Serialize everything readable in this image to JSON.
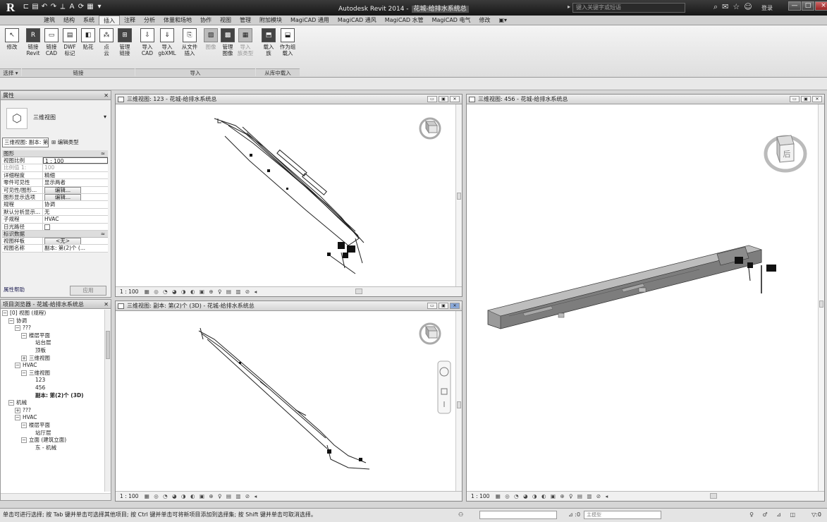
{
  "app": {
    "title": "Autodesk Revit 2014 -",
    "document": "花城-给排水系统总",
    "logo": "R",
    "qat_icons": [
      "open-icon",
      "save-icon",
      "undo-icon",
      "redo-icon",
      "measure-icon",
      "text-icon",
      "sync-icon",
      "switch-windows-icon",
      "dropdown-icon"
    ],
    "search_placeholder": "键入关键字或短语",
    "login": "登录",
    "win_minimize": "—",
    "win_restore": "□",
    "win_close": "×"
  },
  "ribbon": {
    "tabs": [
      {
        "label": "建筑"
      },
      {
        "label": "结构"
      },
      {
        "label": "系统"
      },
      {
        "label": "插入",
        "active": true
      },
      {
        "label": "注释"
      },
      {
        "label": "分析"
      },
      {
        "label": "体量和场地"
      },
      {
        "label": "协作"
      },
      {
        "label": "视图"
      },
      {
        "label": "管理"
      },
      {
        "label": "附加模块"
      },
      {
        "label": "MagiCAD 通用"
      },
      {
        "label": "MagiCAD 通风"
      },
      {
        "label": "MagiCAD 水管"
      },
      {
        "label": "MagiCAD 电气"
      },
      {
        "label": "修改"
      }
    ],
    "buttons": {
      "modify": "修改",
      "link_revit": "链接\nRevit",
      "link_cad": "链接\nCAD",
      "dwf_markup": "DWF\n标记",
      "decal": "贴花",
      "point_cloud": "点\n云",
      "manage_links": "管理\n链接",
      "import_cad": "导入\nCAD",
      "import_gbxml": "导入\ngbXML",
      "insert_from_file": "从文件\n插入",
      "image": "图像",
      "manage_images": "管理\n图像",
      "import_family_types": "导入\n族类型",
      "load_family": "载入\n族",
      "load_as_group": "作为组\n载入"
    },
    "groups": {
      "select": "选择 ▾",
      "link": "链接",
      "import": "导入",
      "load_from_library": "从库中载入"
    }
  },
  "properties": {
    "title": "属性",
    "type_name": "三维视图",
    "instance_selector": "三维视图: 副本: 第(2",
    "edit_type": "编辑类型",
    "sections": {
      "graphics": "图形",
      "identity": "标识数据"
    },
    "rows_graphics": [
      {
        "k": "视图比例",
        "v": "1 : 100",
        "style": "boxed"
      },
      {
        "k": "比例值 1:",
        "v": "100",
        "style": "gray"
      },
      {
        "k": "详细程度",
        "v": "精细"
      },
      {
        "k": "零件可见性",
        "v": "显示两者"
      },
      {
        "k": "可见性/图形...",
        "v": "编辑...",
        "style": "btn"
      },
      {
        "k": "图形显示选项",
        "v": "编辑...",
        "style": "btn"
      },
      {
        "k": "规程",
        "v": "协调"
      },
      {
        "k": "默认分析显示...",
        "v": "无"
      },
      {
        "k": "子规程",
        "v": "HVAC"
      },
      {
        "k": "日光路径",
        "v": "",
        "style": "check"
      }
    ],
    "rows_identity": [
      {
        "k": "视图样板",
        "v": "<无>",
        "style": "btn"
      },
      {
        "k": "视图名称",
        "v": "副本: 第(2)个 (..."
      }
    ],
    "help_link": "属性帮助",
    "apply": "应用"
  },
  "browser": {
    "title": "项目浏览器 - 花城-给排水系统总",
    "tree": [
      {
        "label": "[0] 视图 (规程)",
        "depth": 0,
        "pm": "−"
      },
      {
        "label": "协调",
        "depth": 1,
        "pm": "−"
      },
      {
        "label": "???",
        "depth": 2,
        "pm": "−"
      },
      {
        "label": "楼层平面",
        "depth": 3,
        "pm": "−"
      },
      {
        "label": "站台层",
        "depth": 4
      },
      {
        "label": "顶板",
        "depth": 4
      },
      {
        "label": "三维视图",
        "depth": 3,
        "pm": "+"
      },
      {
        "label": "HVAC",
        "depth": 2,
        "pm": "−"
      },
      {
        "label": "三维视图",
        "depth": 3,
        "pm": "−"
      },
      {
        "label": "123",
        "depth": 4
      },
      {
        "label": "456",
        "depth": 4
      },
      {
        "label": "副本: 第(2)个 (3D)",
        "depth": 4,
        "sel": true
      },
      {
        "label": "机械",
        "depth": 1,
        "pm": "−"
      },
      {
        "label": "???",
        "depth": 2,
        "pm": "+"
      },
      {
        "label": "HVAC",
        "depth": 2,
        "pm": "−"
      },
      {
        "label": "楼层平面",
        "depth": 3,
        "pm": "−"
      },
      {
        "label": "站厅层",
        "depth": 4
      },
      {
        "label": "立面 (建筑立面)",
        "depth": 3,
        "pm": "−"
      },
      {
        "label": "东 - 机械",
        "depth": 4
      }
    ]
  },
  "views": {
    "v1": {
      "title": "三维视图: 123 - 花城-给排水系统总",
      "scale": "1 : 100"
    },
    "v2": {
      "title": "三维视图: 副本: 第(2)个 (3D) - 花城-给排水系统总",
      "scale": "1 : 100"
    },
    "v3": {
      "title": "三维视图: 456 - 花城-给排水系统总",
      "scale": "1 : 100"
    },
    "view_bar_icons": "▦ ◎ ◔ ◕ ◑ ◐ ▣ ⊕ ♀ ▤ ▥ ⊘ ◂",
    "viewcube_face": "后",
    "ctl": [
      "▭",
      "▣",
      "✕"
    ]
  },
  "status": {
    "text": "单击可进行选择; 按 Tab 键并单击可选择其他项目; 按 Ctrl 键并单击可将新项目添加到选择集; 按 Shift 键并单击可取消选择。",
    "workset": "⊿ :0",
    "model": "主模型",
    "filter": "▽:0",
    "icons": "♀ ♂ ⊿ ◫"
  }
}
